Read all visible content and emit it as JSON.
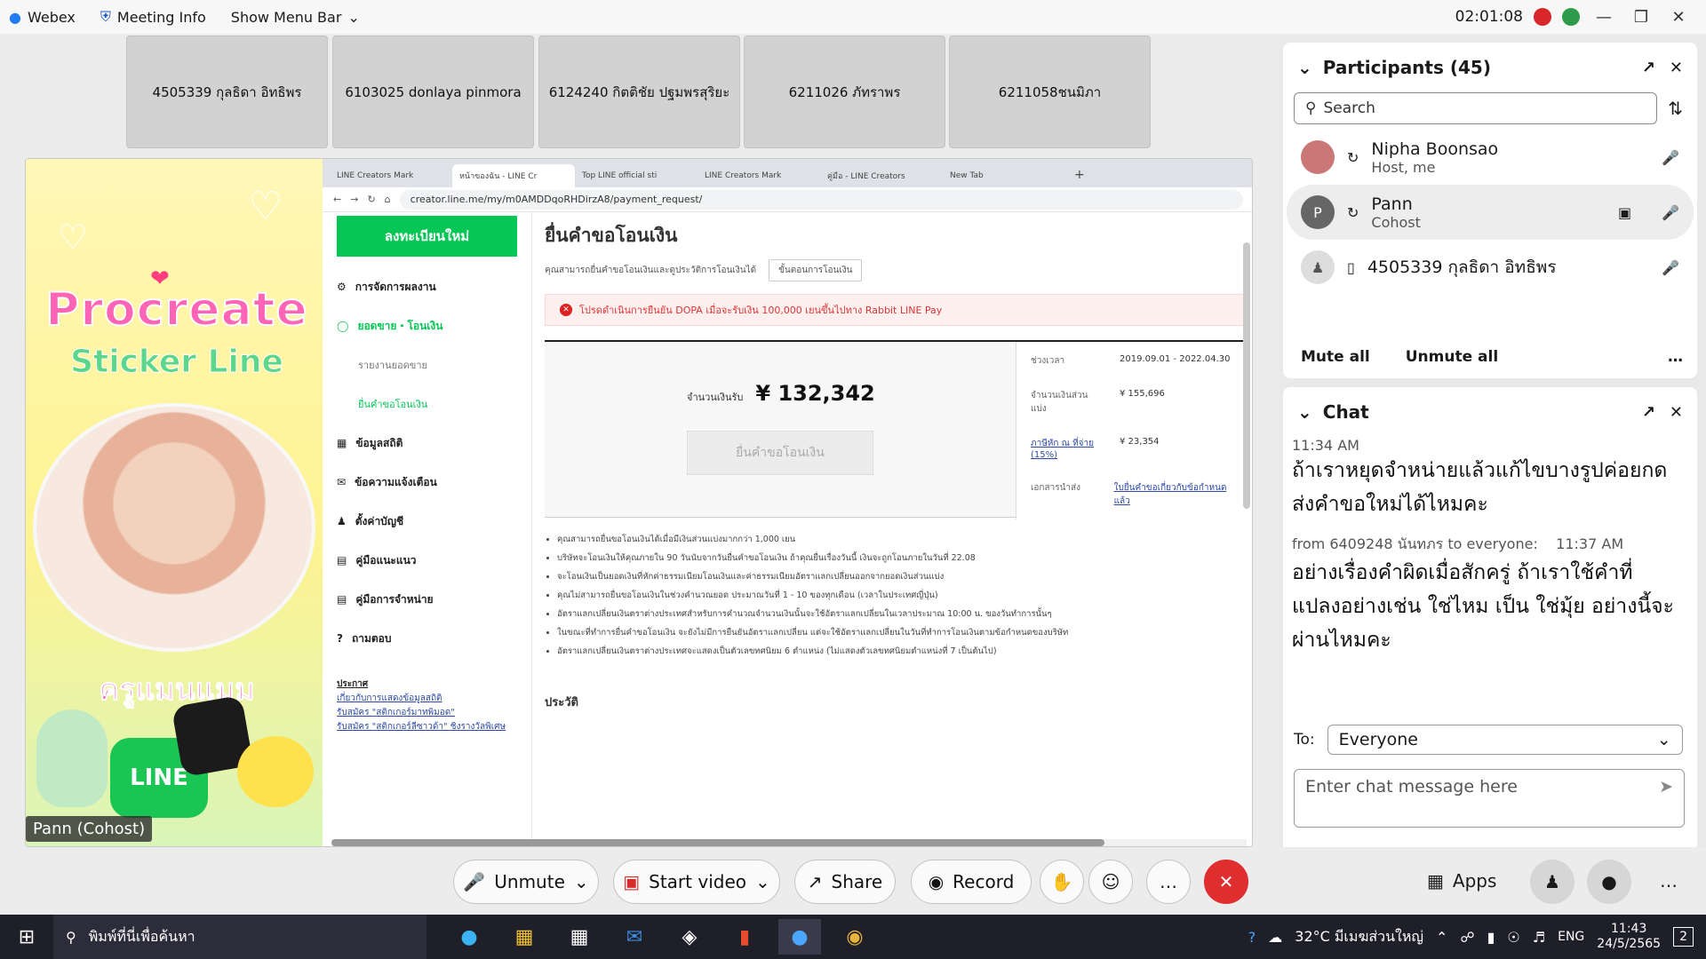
{
  "topbar": {
    "app": "Webex",
    "meeting_info": "Meeting Info",
    "menu": "Show Menu Bar",
    "clock": "02:01:08"
  },
  "tiles": [
    "4505339 กุลธิดา อิทธิพร",
    "6103025 donlaya pinmora",
    "6124240 กิตติชัย ปฐมพรสุริยะ",
    "6211026 ภัทราพร",
    "6211058ชนมิภา"
  ],
  "camera": {
    "title1": "Procreate",
    "title2": "Sticker Line",
    "caption": "ครูแมนแมม",
    "line": "LINE",
    "name_label": "Pann (Cohost)"
  },
  "browser": {
    "tabs": [
      "LINE Creators Mark",
      "หน้าของฉัน - LINE Cr",
      "Top LINE official sti",
      "LINE Creators Mark",
      "คู่มือ - LINE Creators",
      "New Tab"
    ],
    "url": "creator.line.me/my/m0AMDDqoRHDirzA8/payment_request/",
    "register": "ลงทะเบียนใหม่",
    "nav": [
      "การจัดการผลงาน",
      "ยอดขาย・โอนเงิน",
      "รายงานยอดขาย",
      "ยื่นคำขอโอนเงิน",
      "ข้อมูลสถิติ",
      "ข้อความแจ้งเตือน",
      "ตั้งค่าบัญชี",
      "คู่มือแนะแนว",
      "คู่มือการจำหน่าย",
      "ถามตอบ"
    ],
    "links": [
      "ประกาศ",
      "เกี่ยวกับการแสดงข้อมูลสถิติ",
      "รับสมัคร \"สติกเกอร์มาทพิมอด\"",
      "รับสมัคร \"สติกเกอร์ลีซาวด้า\" ชิงรางวัลพิเศษ"
    ],
    "heading": "ยื่นคำขอโอนเงิน",
    "subtitle": "คุณสามารถยื่นคำขอโอนเงินและดูประวัติการโอนเงินได้",
    "steps": "ขั้นตอนการโอนเงิน",
    "alert": "โปรดดำเนินการยืนยัน DOPA เมื่อจะรับเงิน 100,000 เยนขึ้นไปทาง Rabbit LINE Pay",
    "amount_label": "จำนวนเงินรับ",
    "amount": "¥ 132,342",
    "request_btn": "ยื่นคำขอโอนเงิน",
    "period_label": "ช่วงเวลา",
    "period": "2019.09.01 - 2022.04.30",
    "share_label": "จำนวนเงินส่วนแบ่ง",
    "share": "¥ 155,696",
    "tax_label": "ภาษีหัก ณ ที่จ่าย (15%)",
    "tax": "¥ 23,354",
    "doc_label": "เอกสารนำส่ง",
    "doc": "ใบยื่นคำขอเกี่ยวกับข้อกำหนดแล้ว",
    "bullets": [
      "คุณสามารถยื่นขอโอนเงินได้เมื่อมีเงินส่วนแบ่งมากกว่า 1,000 เยน",
      "บริษัทจะโอนเงินให้คุณภายใน 90 วันนับจากวันยื่นคำขอโอนเงิน ถ้าคุณยื่นเรื่องวันนี้ เงินจะถูกโอนภายในวันที่ 22.08",
      "จะโอนเงินเป็นยอดเงินที่หักค่าธรรมเนียมโอนเงินและค่าธรรมเนียมอัตราแลกเปลี่ยนออกจากยอดเงินส่วนแบ่ง",
      "คุณไม่สามารถยื่นขอโอนเงินในช่วงคำนวณยอด ประมาณวันที่ 1 - 10 ของทุกเดือน (เวลาในประเทศญี่ปุ่น)",
      "อัตราแลกเปลี่ยนเงินตราต่างประเทศสำหรับการคำนวณจำนวนเงินนั้นจะใช้อัตราแลกเปลี่ยนในเวลาประมาณ 10:00 น. ของวันทำการนั้นๆ",
      "ในขณะที่ทำการยื่นคำขอโอนเงิน จะยังไม่มีการยืนยันอัตราแลกเปลี่ยน แต่จะใช้อัตราแลกเปลี่ยนในวันที่ทำการโอนเงินตามข้อกำหนดของบริษัท",
      "อัตราแลกเปลี่ยนเงินตราต่างประเทศจะแสดงเป็นตัวเลขทศนิยม 6 ตำแหน่ง (ไม่แสดงตัวเลขทศนิยมตำแหน่งที่ 7 เป็นต้นไป)"
    ],
    "history": "ประวัติ"
  },
  "participants": {
    "title": "Participants (45)",
    "search_placeholder": "Search",
    "list": [
      {
        "name": "Nipha Boonsao",
        "role": "Host, me"
      },
      {
        "name": "Pann",
        "role": "Cohost",
        "initial": "P"
      },
      {
        "name": "4505339 กุลธิดา อิทธิพร",
        "role": ""
      }
    ],
    "mute_all": "Mute all",
    "unmute_all": "Unmute all"
  },
  "chat": {
    "title": "Chat",
    "time1": "11:34 AM",
    "msg1": "ถ้าเราหยุดจำหน่ายแล้วแก้ไขบางรูปค่อยกดส่งคำขอใหม่ได้ไหมคะ",
    "from2": "from 6409248 นันทภร to everyone:",
    "time2": "11:37 AM",
    "msg2": "อย่างเรื่องคำผิดเมื่อสักครู่ ถ้าเราใช้คำที่แปลงอย่างเช่น ใช่ไหม เป็น ใช่มุ้ย อย่างนี้จะผ่านไหมคะ",
    "to_label": "To:",
    "to_value": "Everyone",
    "input_placeholder": "Enter chat message here"
  },
  "controls": {
    "unmute": "Unmute",
    "start_video": "Start video",
    "share": "Share",
    "record": "Record",
    "apps": "Apps"
  },
  "taskbar": {
    "search": "พิมพ์ที่นี่เพื่อค้นหา",
    "weather": "32°C มีเมฆส่วนใหญ่",
    "lang": "ENG",
    "time": "11:43",
    "date": "24/5/2565",
    "notif": "2"
  }
}
